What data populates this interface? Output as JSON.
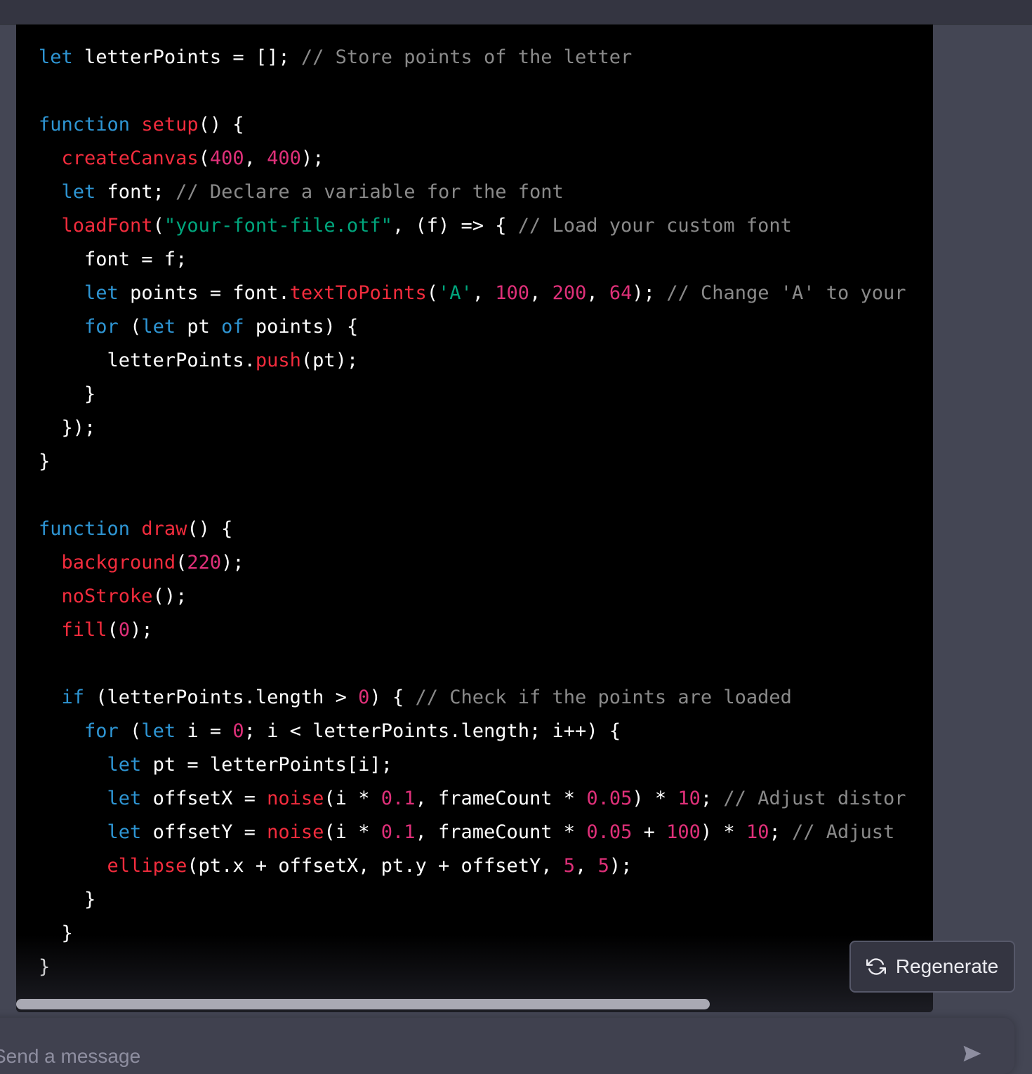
{
  "composer": {
    "placeholder": "Send a message"
  },
  "actions": {
    "regenerate_label": "Regenerate"
  },
  "icons": {
    "regenerate": "refresh-icon",
    "send": "send-icon"
  },
  "colors": {
    "keyword": "#2e95d3",
    "function": "#f22c3d",
    "number": "#df3079",
    "string": "#00a67d",
    "comment": "#8a8a8a",
    "text": "#ffffff",
    "code_background": "#000000",
    "page_background": "#444654"
  },
  "code": {
    "language": "javascript",
    "lines": [
      [
        [
          "k",
          "let"
        ],
        [
          "p",
          " letterPoints = []; "
        ],
        [
          "c",
          "// Store points of the letter"
        ]
      ],
      [],
      [
        [
          "k",
          "function"
        ],
        [
          "p",
          " "
        ],
        [
          "f",
          "setup"
        ],
        [
          "p",
          "() {"
        ]
      ],
      [
        [
          "p",
          "  "
        ],
        [
          "f",
          "createCanvas"
        ],
        [
          "p",
          "("
        ],
        [
          "n",
          "400"
        ],
        [
          "p",
          ", "
        ],
        [
          "n",
          "400"
        ],
        [
          "p",
          ");"
        ]
      ],
      [
        [
          "p",
          "  "
        ],
        [
          "k",
          "let"
        ],
        [
          "p",
          " font; "
        ],
        [
          "c",
          "// Declare a variable for the font"
        ]
      ],
      [
        [
          "p",
          "  "
        ],
        [
          "f",
          "loadFont"
        ],
        [
          "p",
          "("
        ],
        [
          "s",
          "\"your-font-file.otf\""
        ],
        [
          "p",
          ", (f) => { "
        ],
        [
          "c",
          "// Load your custom font"
        ]
      ],
      [
        [
          "p",
          "    font = f;"
        ]
      ],
      [
        [
          "p",
          "    "
        ],
        [
          "k",
          "let"
        ],
        [
          "p",
          " points = font."
        ],
        [
          "f",
          "textToPoints"
        ],
        [
          "p",
          "("
        ],
        [
          "s",
          "'A'"
        ],
        [
          "p",
          ", "
        ],
        [
          "n",
          "100"
        ],
        [
          "p",
          ", "
        ],
        [
          "n",
          "200"
        ],
        [
          "p",
          ", "
        ],
        [
          "n",
          "64"
        ],
        [
          "p",
          "); "
        ],
        [
          "c",
          "// Change 'A' to your"
        ]
      ],
      [
        [
          "p",
          "    "
        ],
        [
          "k",
          "for"
        ],
        [
          "p",
          " ("
        ],
        [
          "k",
          "let"
        ],
        [
          "p",
          " pt "
        ],
        [
          "k",
          "of"
        ],
        [
          "p",
          " points) {"
        ]
      ],
      [
        [
          "p",
          "      letterPoints."
        ],
        [
          "f",
          "push"
        ],
        [
          "p",
          "(pt);"
        ]
      ],
      [
        [
          "p",
          "    }"
        ]
      ],
      [
        [
          "p",
          "  });"
        ]
      ],
      [
        [
          "p",
          "}"
        ]
      ],
      [],
      [
        [
          "k",
          "function"
        ],
        [
          "p",
          " "
        ],
        [
          "f",
          "draw"
        ],
        [
          "p",
          "() {"
        ]
      ],
      [
        [
          "p",
          "  "
        ],
        [
          "f",
          "background"
        ],
        [
          "p",
          "("
        ],
        [
          "n",
          "220"
        ],
        [
          "p",
          ");"
        ]
      ],
      [
        [
          "p",
          "  "
        ],
        [
          "f",
          "noStroke"
        ],
        [
          "p",
          "();"
        ]
      ],
      [
        [
          "p",
          "  "
        ],
        [
          "f",
          "fill"
        ],
        [
          "p",
          "("
        ],
        [
          "n",
          "0"
        ],
        [
          "p",
          ");"
        ]
      ],
      [],
      [
        [
          "p",
          "  "
        ],
        [
          "k",
          "if"
        ],
        [
          "p",
          " (letterPoints.length > "
        ],
        [
          "n",
          "0"
        ],
        [
          "p",
          ") { "
        ],
        [
          "c",
          "// Check if the points are loaded"
        ]
      ],
      [
        [
          "p",
          "    "
        ],
        [
          "k",
          "for"
        ],
        [
          "p",
          " ("
        ],
        [
          "k",
          "let"
        ],
        [
          "p",
          " i = "
        ],
        [
          "n",
          "0"
        ],
        [
          "p",
          "; i < letterPoints.length; i++) {"
        ]
      ],
      [
        [
          "p",
          "      "
        ],
        [
          "k",
          "let"
        ],
        [
          "p",
          " pt = letterPoints[i];"
        ]
      ],
      [
        [
          "p",
          "      "
        ],
        [
          "k",
          "let"
        ],
        [
          "p",
          " offsetX = "
        ],
        [
          "f",
          "noise"
        ],
        [
          "p",
          "(i * "
        ],
        [
          "n",
          "0.1"
        ],
        [
          "p",
          ", frameCount * "
        ],
        [
          "n",
          "0.05"
        ],
        [
          "p",
          ") * "
        ],
        [
          "n",
          "10"
        ],
        [
          "p",
          "; "
        ],
        [
          "c",
          "// Adjust distor"
        ]
      ],
      [
        [
          "p",
          "      "
        ],
        [
          "k",
          "let"
        ],
        [
          "p",
          " offsetY = "
        ],
        [
          "f",
          "noise"
        ],
        [
          "p",
          "(i * "
        ],
        [
          "n",
          "0.1"
        ],
        [
          "p",
          ", frameCount * "
        ],
        [
          "n",
          "0.05"
        ],
        [
          "p",
          " + "
        ],
        [
          "n",
          "100"
        ],
        [
          "p",
          ") * "
        ],
        [
          "n",
          "10"
        ],
        [
          "p",
          "; "
        ],
        [
          "c",
          "// Adjust "
        ]
      ],
      [
        [
          "p",
          "      "
        ],
        [
          "f",
          "ellipse"
        ],
        [
          "p",
          "(pt.x + offsetX, pt.y + offsetY, "
        ],
        [
          "n",
          "5"
        ],
        [
          "p",
          ", "
        ],
        [
          "n",
          "5"
        ],
        [
          "p",
          ");"
        ]
      ],
      [
        [
          "p",
          "    }"
        ]
      ],
      [
        [
          "p",
          "  }"
        ]
      ],
      [
        [
          "p",
          "}"
        ]
      ]
    ]
  }
}
